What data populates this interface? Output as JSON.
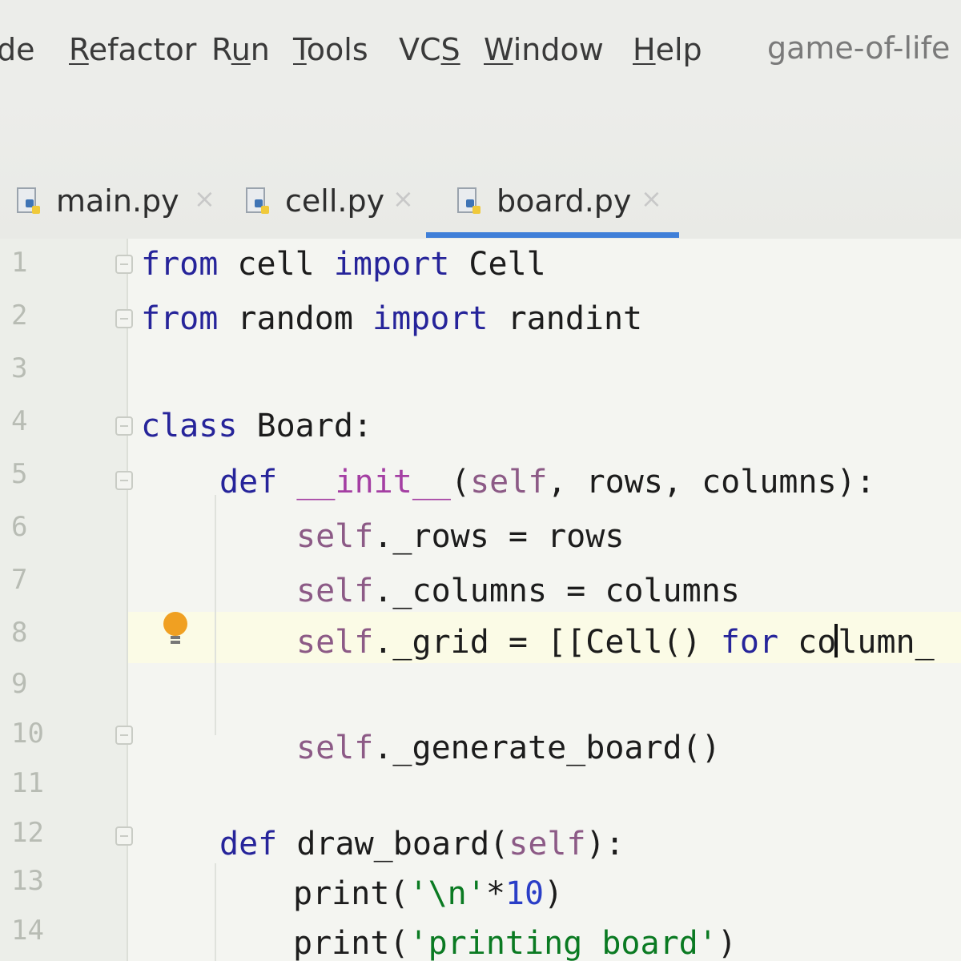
{
  "menu": {
    "items": [
      {
        "pre": "",
        "mnemonic": "",
        "post": "de"
      },
      {
        "pre": "",
        "mnemonic": "R",
        "post": "efactor"
      },
      {
        "pre": "R",
        "mnemonic": "u",
        "post": "n"
      },
      {
        "pre": "",
        "mnemonic": "T",
        "post": "ools"
      },
      {
        "pre": "VC",
        "mnemonic": "S",
        "post": ""
      },
      {
        "pre": "",
        "mnemonic": "W",
        "post": "indow"
      },
      {
        "pre": "",
        "mnemonic": "H",
        "post": "elp"
      }
    ],
    "project_title": "game-of-life"
  },
  "tabs": [
    {
      "label": "main.py",
      "close": "×",
      "active": false
    },
    {
      "label": "cell.py",
      "close": "×",
      "active": false
    },
    {
      "label": "board.py",
      "close": "×",
      "active": true
    }
  ],
  "editor": {
    "line_numbers": [
      "1",
      "2",
      "3",
      "4",
      "5",
      "6",
      "7",
      "8",
      "9",
      "10",
      "11",
      "12",
      "13",
      "14"
    ],
    "code": {
      "l1": {
        "kw1": "from",
        "mod": " cell ",
        "kw2": "import",
        "name": " Cell"
      },
      "l2": {
        "kw1": "from",
        "mod": " random ",
        "kw2": "import",
        "name": " randint"
      },
      "l4": {
        "kw": "class",
        "name": " Board:"
      },
      "l5": {
        "kw": "def",
        "sp": " ",
        "dunder": "__init__",
        "open": "(",
        "self": "self",
        "rest": ", rows, columns):"
      },
      "l6": {
        "self": "self",
        "rest": "._rows = rows"
      },
      "l7": {
        "self": "self",
        "rest": "._columns = columns"
      },
      "l8": {
        "self": "self",
        "mid": "._grid = [[Cell() ",
        "kw": "for",
        "before_caret": " co",
        "after_caret": "lumn_"
      },
      "l10": {
        "self": "self",
        "rest": "._generate_board()"
      },
      "l12": {
        "kw": "def",
        "name": " draw_board(",
        "self": "self",
        "rest": "):"
      },
      "l13": {
        "fn": "print(",
        "str": "'\\n'",
        "op": "*",
        "num": "10",
        "close": ")"
      },
      "l14": {
        "fn": "print(",
        "str": "'printing board'",
        "close": ")"
      }
    }
  },
  "colors": {
    "keyword": "#26249a",
    "self": "#8c5a86",
    "dunder": "#a43fa3",
    "string": "#0a7a22",
    "number": "#2a3ec7",
    "active_tab_underline": "#3f7fd8",
    "lightbulb": "#f0a022"
  }
}
